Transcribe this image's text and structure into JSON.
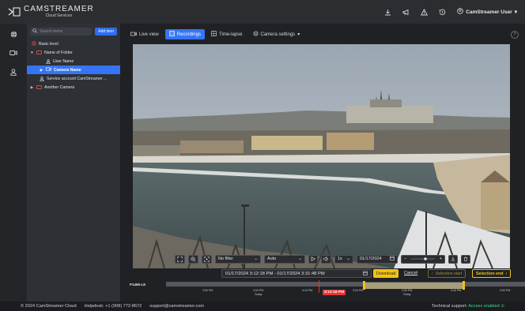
{
  "app": {
    "logo_title": "CAMSTREAMER",
    "logo_subtitle": "Cloud Services",
    "user_label": "CamStreamer User"
  },
  "topbar_icons": [
    "download-icon",
    "megaphone-icon",
    "warning-icon",
    "history-icon",
    "user-circle-icon"
  ],
  "sidenav_icons": [
    "globe-icon",
    "camera-icon",
    "user-icon"
  ],
  "tree": {
    "search_placeholder": "Search items",
    "add_label": "Add item",
    "rows": [
      {
        "label": "Basic level"
      },
      {
        "label": "Name of Folder"
      },
      {
        "label": "User Name"
      },
      {
        "label": "Camera Name"
      },
      {
        "label": "Service account CamStreamer ..."
      },
      {
        "label": "Another Camera"
      }
    ]
  },
  "tabs": [
    {
      "label": "Live view"
    },
    {
      "label": "Recordings"
    },
    {
      "label": "Time-lapse"
    },
    {
      "label": "Camera settings"
    }
  ],
  "controls": {
    "filter": "No filter",
    "quality": "Auto",
    "speed": "1x",
    "date": "01/17/2024"
  },
  "range": {
    "text": "01/17/2024 3:12:18 PM - 01/17/2024 3:31:48 PM",
    "download": "Download",
    "cancel": "Cancel",
    "selection_start": "Selection start",
    "selection_end": "Selection end"
  },
  "timeline": {
    "camera_label": "P1465-LE",
    "now": "3:12:18 PM",
    "ticks": [
      {
        "t": "2:50 PM",
        "sub": ""
      },
      {
        "t": "3:00 PM",
        "sub": "Today"
      },
      {
        "t": "3:10 PM",
        "sub": ""
      },
      {
        "t": "3:20 PM",
        "sub": ""
      },
      {
        "t": "3:30 PM",
        "sub": "Today"
      },
      {
        "t": "3:40 PM",
        "sub": ""
      },
      {
        "t": "3:50 PM",
        "sub": ""
      }
    ]
  },
  "footer": {
    "copyright": "© 2024 CamStreamer Cloud",
    "helpdesk": "Helpdesk: +1 (908) 772-8672",
    "email": "support@camstreamer.com",
    "tech_support": "Technical support:",
    "status": "Access enabled"
  },
  "colors": {
    "accent": "#3575f5",
    "highlight": "#f1c40f",
    "live": "#e53935",
    "ok": "#3ddc84"
  }
}
